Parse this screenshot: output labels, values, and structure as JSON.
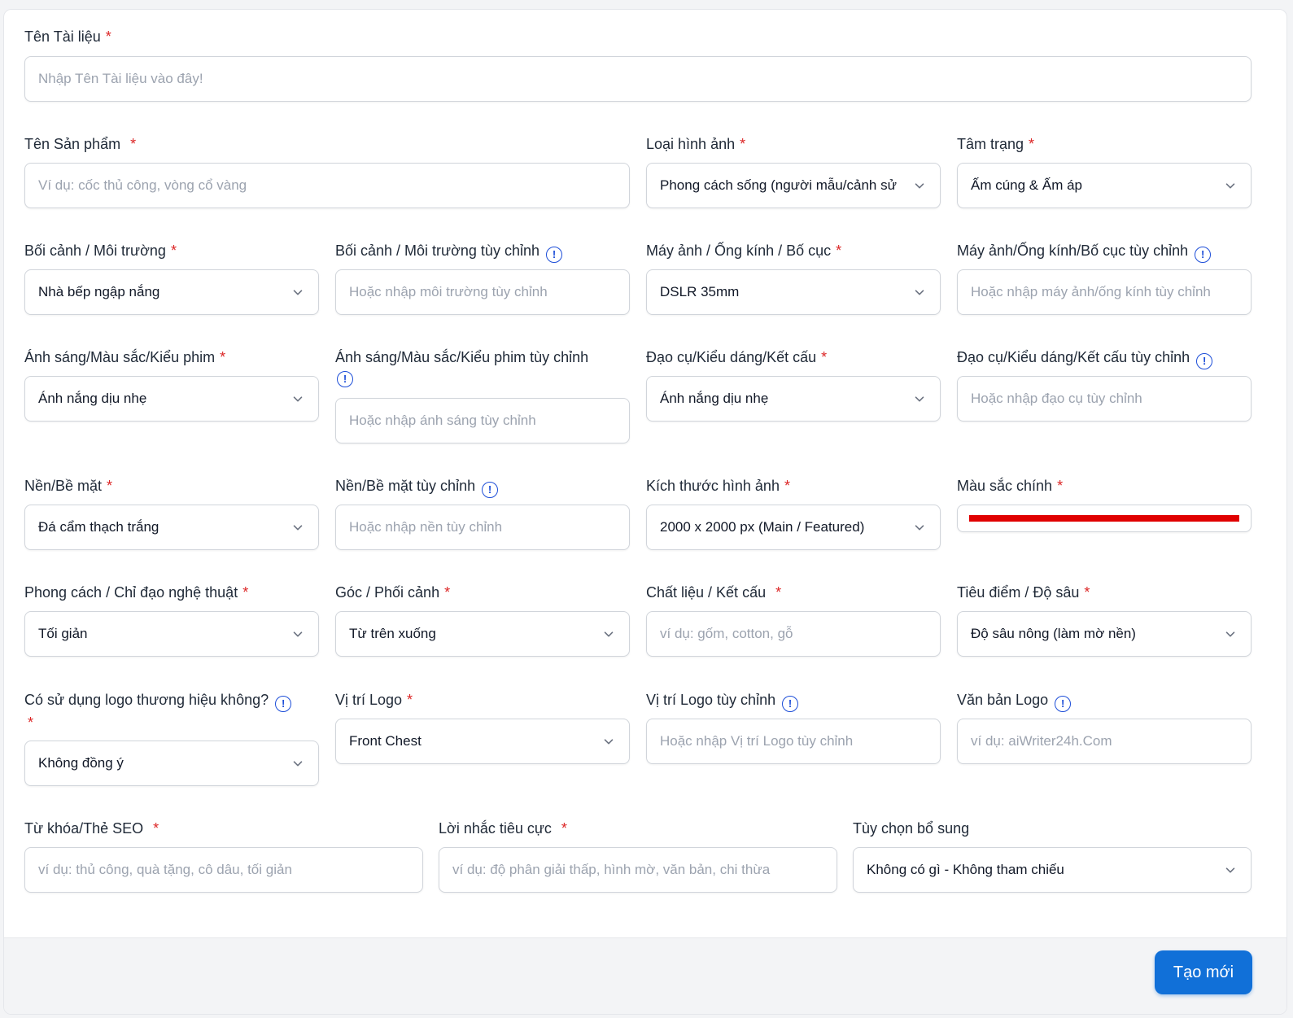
{
  "form": {
    "doc_name": {
      "label": "Tên Tài liệu",
      "required": "*",
      "placeholder": "Nhập Tên Tài liệu vào đây!"
    },
    "product_name": {
      "label": "Tên Sản phẩm",
      "required": "*",
      "placeholder": "Ví dụ: cốc thủ công, vòng cổ vàng"
    },
    "image_type": {
      "label": "Loại hình ảnh",
      "required": "*",
      "value": "Phong cách sống (người mẫu/cảnh sử"
    },
    "mood": {
      "label": "Tâm trạng",
      "required": "*",
      "value": "Ấm cúng & Ấm áp"
    },
    "context": {
      "label": "Bối cảnh / Môi trường",
      "required": "*",
      "value": "Nhà bếp ngập nắng"
    },
    "context_custom": {
      "label": "Bối cảnh / Môi trường tùy chỉnh",
      "placeholder": "Hoặc nhập môi trường tùy chỉnh"
    },
    "camera": {
      "label": "Máy ảnh / Ống kính / Bố cục",
      "required": "*",
      "value": "DSLR 35mm"
    },
    "camera_custom": {
      "label": "Máy ảnh/Ống kính/Bố cục tùy chỉnh",
      "placeholder": "Hoặc nhập máy ảnh/ống kính tùy chỉnh"
    },
    "lighting": {
      "label": "Ánh sáng/Màu sắc/Kiểu phim",
      "required": "*",
      "value": "Ánh nắng dịu nhẹ"
    },
    "lighting_custom": {
      "label": "Ánh sáng/Màu sắc/Kiểu phim tùy chỉnh",
      "placeholder": "Hoặc nhập ánh sáng tùy chỉnh"
    },
    "props": {
      "label": "Đạo cụ/Kiểu dáng/Kết cấu",
      "required": "*",
      "value": "Ánh nắng dịu nhẹ"
    },
    "props_custom": {
      "label": "Đạo cụ/Kiểu dáng/Kết cấu tùy chỉnh",
      "placeholder": "Hoặc nhập đạo cụ tùy chỉnh"
    },
    "background": {
      "label": "Nền/Bề mặt",
      "required": "*",
      "value": "Đá cẩm thạch trắng"
    },
    "background_custom": {
      "label": "Nền/Bề mặt tùy chỉnh",
      "placeholder": "Hoặc nhập nền tùy chỉnh"
    },
    "image_size": {
      "label": "Kích thước hình ảnh",
      "required": "*",
      "value": "2000 x 2000 px (Main / Featured)"
    },
    "main_color": {
      "label": "Màu sắc chính",
      "required": "*",
      "color": "#e00000"
    },
    "art_style": {
      "label": "Phong cách / Chỉ đạo nghệ thuật",
      "required": "*",
      "value": "Tối giản"
    },
    "angle": {
      "label": "Góc / Phối cảnh",
      "required": "*",
      "value": "Từ trên xuống"
    },
    "material": {
      "label": "Chất liệu / Kết cấu",
      "required": "*",
      "placeholder": "ví dụ: gốm, cotton, gỗ"
    },
    "focus": {
      "label": "Tiêu điểm / Độ sâu",
      "required": "*",
      "value": "Độ sâu nông (làm mờ nền)"
    },
    "use_logo": {
      "label": "Có sử dụng logo thương hiệu không?",
      "required": "*",
      "value": "Không đồng ý"
    },
    "logo_position": {
      "label": "Vị trí Logo",
      "required": "*",
      "value": "Front Chest"
    },
    "logo_position_custom": {
      "label": "Vị trí Logo tùy chỉnh",
      "placeholder": "Hoặc nhập Vị trí Logo tùy chỉnh"
    },
    "logo_text": {
      "label": "Văn bản Logo",
      "placeholder": "ví dụ: aiWriter24h.Com"
    },
    "seo": {
      "label": "Từ khóa/Thẻ SEO",
      "required": "*",
      "placeholder": "ví dụ: thủ công, quà tặng, cô dâu, tối giản"
    },
    "negative": {
      "label": "Lời nhắc tiêu cực",
      "required": "*",
      "placeholder": "ví dụ: độ phân giải thấp, hình mờ, văn bản, chi thừa"
    },
    "extra": {
      "label": "Tùy chọn bổ sung",
      "value": "Không có gì - Không tham chiếu"
    },
    "info_glyph": "!"
  },
  "footer": {
    "submit_label": "Tạo mới"
  },
  "colors": {
    "accent": "#1170d8",
    "required": "#dc2626",
    "info": "#1d4ed8"
  },
  "icons": {
    "dropdown": "chevron-down-icon",
    "info": "info-circle-icon"
  }
}
